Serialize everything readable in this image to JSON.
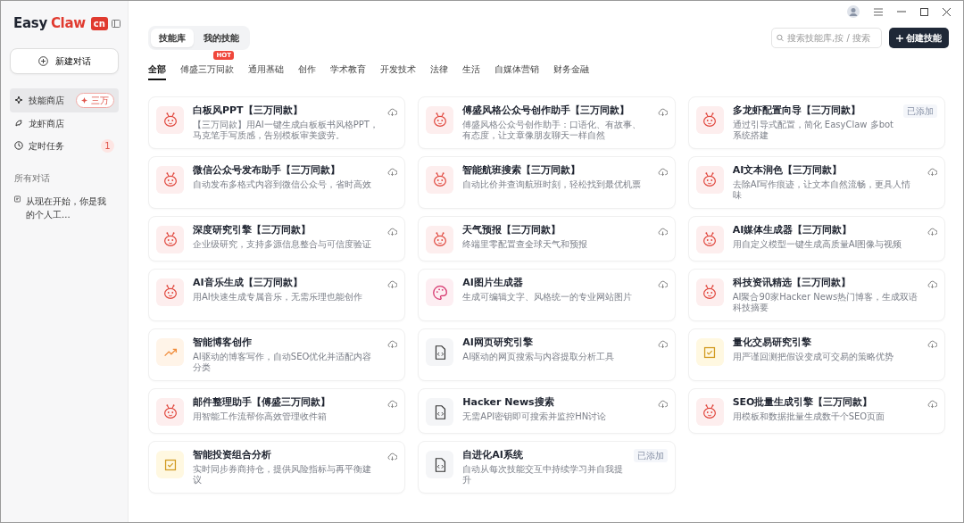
{
  "logo": {
    "part_1": "Easy",
    "part_2": "Claw",
    "tag": "cn"
  },
  "sidebar": {
    "new_chat": "新建对话",
    "items": [
      {
        "label": "技能商店",
        "selected": true,
        "badge": "三万"
      },
      {
        "label": "龙虾商店",
        "selected": false
      },
      {
        "label": "定时任务",
        "selected": false,
        "badge": "1"
      }
    ],
    "section_title": "所有对话",
    "conversations": [
      {
        "label": "从现在开始，你是我的个人工..."
      }
    ]
  },
  "tabs": [
    {
      "label": "技能库",
      "selected": true
    },
    {
      "label": "我的技能",
      "selected": false
    }
  ],
  "search": {
    "placeholder": "搜索技能库,按 / 搜索"
  },
  "create_button": "创建技能",
  "categories": [
    {
      "label": "全部",
      "selected": true
    },
    {
      "label": "傅盛三万同款",
      "selected": false,
      "badge": "HOT"
    },
    {
      "label": "通用基础",
      "selected": false
    },
    {
      "label": "创作",
      "selected": false
    },
    {
      "label": "学术教育",
      "selected": false
    },
    {
      "label": "开发技术",
      "selected": false
    },
    {
      "label": "法律",
      "selected": false
    },
    {
      "label": "生活",
      "selected": false
    },
    {
      "label": "自媒体营销",
      "selected": false
    },
    {
      "label": "财务金融",
      "selected": false
    }
  ],
  "skills": [
    {
      "kind": "lobster",
      "title": "白板风PPT【三万同款】",
      "description": "【三万同款】用AI一键生成白板板书风格PPT，马克笔手写质感，告别模板审美疲劳。",
      "added": false
    },
    {
      "kind": "lobster",
      "title": "傅盛风格公众号创作助手【三万同款】",
      "description": "傅盛风格公众号创作助手：口语化、有故事、有态度，让文章像朋友聊天一样自然",
      "added": false
    },
    {
      "kind": "lobster",
      "title": "多龙虾配置向导【三万同款】",
      "description": "通过引导式配置，简化 EasyClaw 多bot系统搭建",
      "added": true,
      "added_label": "已添加"
    },
    {
      "kind": "lobster",
      "title": "微信公众号发布助手【三万同款】",
      "description": "自动发布多格式内容到微信公众号，省时高效",
      "added": false
    },
    {
      "kind": "lobster",
      "title": "智能航班搜索【三万同款】",
      "description": "自动比价并查询航班时刻，轻松找到最优机票",
      "added": false
    },
    {
      "kind": "lobster",
      "title": "AI文本润色【三万同款】",
      "description": "去除AI写作痕迹，让文本自然流畅，更具人情味",
      "added": false
    },
    {
      "kind": "lobster",
      "title": "深度研究引擎【三万同款】",
      "description": "企业级研究，支持多源信息整合与可信度验证",
      "added": false
    },
    {
      "kind": "lobster",
      "title": "天气预报【三万同款】",
      "description": "终端里零配置查全球天气和预报",
      "added": false
    },
    {
      "kind": "lobster",
      "title": "AI媒体生成器【三万同款】",
      "description": "用自定义模型一键生成高质量AI图像与视频",
      "added": false
    },
    {
      "kind": "lobster",
      "title": "AI音乐生成【三万同款】",
      "description": "用AI快速生成专属音乐，无需乐理也能创作",
      "added": false
    },
    {
      "kind": "palette",
      "title": "AI图片生成器",
      "description": "生成可编辑文字、风格统一的专业网站图片",
      "added": false
    },
    {
      "kind": "lobster",
      "title": "科技资讯精选【三万同款】",
      "description": "AI聚合90家Hacker News热门博客，生成双语科技摘要",
      "added": false
    },
    {
      "kind": "trend",
      "title": "智能博客创作",
      "description": "AI驱动的博客写作，自动SEO优化并适配内容分类",
      "added": false
    },
    {
      "kind": "code",
      "title": "AI网页研究引擎",
      "description": "AI驱动的网页搜索与内容提取分析工具",
      "added": false
    },
    {
      "kind": "check",
      "title": "量化交易研究引擎",
      "description": "用严谨回测把假设变成可交易的策略优势",
      "added": false
    },
    {
      "kind": "lobster",
      "title": "邮件整理助手【傅盛三万同款】",
      "description": "用智能工作流帮你高效管理收件箱",
      "added": false
    },
    {
      "kind": "code",
      "title": "Hacker News搜索",
      "description": "无需API密钥即可搜索并监控HN讨论",
      "added": false
    },
    {
      "kind": "lobster",
      "title": "SEO批量生成引擎【三万同款】",
      "description": "用模板和数据批量生成数千个SEO页面",
      "added": false
    },
    {
      "kind": "check",
      "title": "智能投资组合分析",
      "description": "实时同步券商持仓，提供风险指标与再平衡建议",
      "added": false
    },
    {
      "kind": "code",
      "title": "自进化AI系统",
      "description": "自动从每次技能交互中持续学习并自我提升",
      "added": true,
      "added_label": "已添加"
    }
  ]
}
